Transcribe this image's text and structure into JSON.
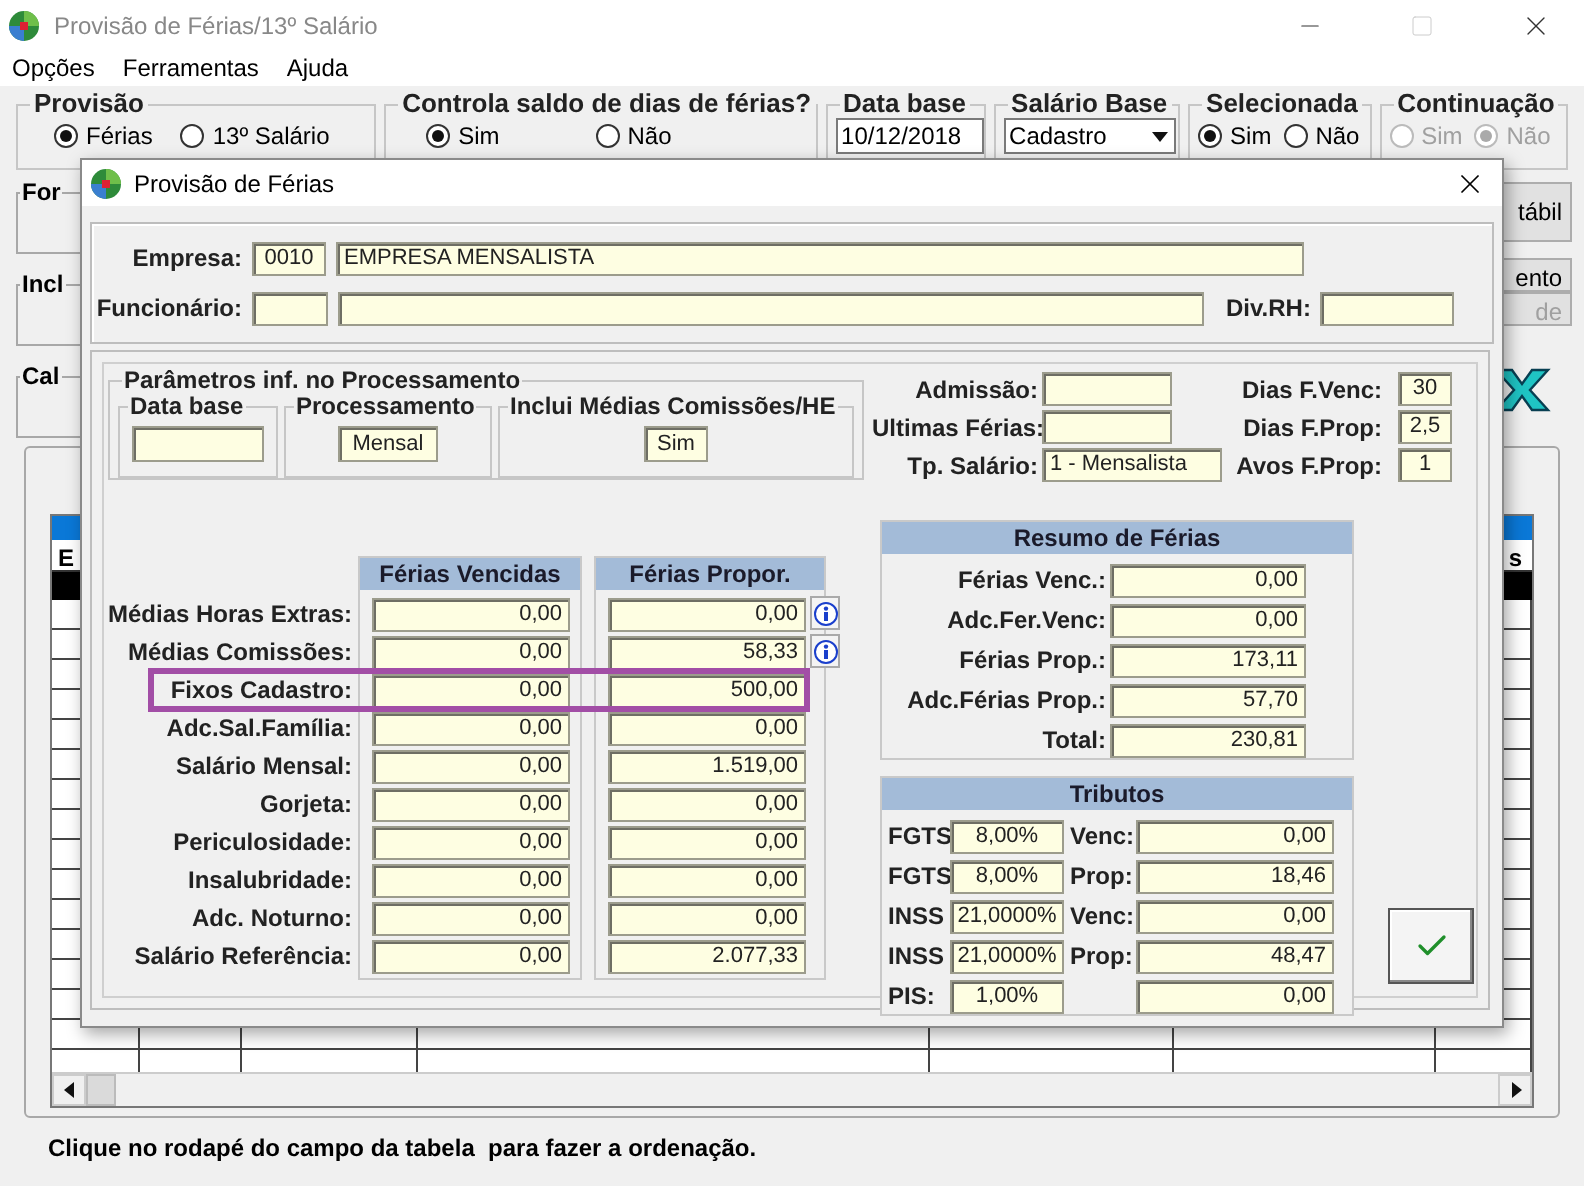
{
  "window": {
    "title": "Provisão de Férias/13º Salário"
  },
  "menu": [
    {
      "label": "Opções"
    },
    {
      "label": "Ferramentas"
    },
    {
      "label": "Ajuda"
    }
  ],
  "top_groups": [
    {
      "title": "Provisão",
      "kind": "radio",
      "options": [
        {
          "label": "Férias",
          "selected": true,
          "disabled": false
        },
        {
          "label": "13º Salário",
          "selected": false,
          "disabled": false
        }
      ]
    },
    {
      "title": "Controla saldo de dias de férias?",
      "kind": "radio",
      "options": [
        {
          "label": "Sim",
          "selected": true,
          "disabled": false
        },
        {
          "label": "Não",
          "selected": false,
          "disabled": false
        }
      ]
    },
    {
      "title": "Data base",
      "kind": "field",
      "value": "10/12/2018"
    },
    {
      "title": "Salário Base",
      "kind": "select",
      "value": "Cadastro"
    },
    {
      "title": "Selecionada",
      "kind": "radio",
      "options": [
        {
          "label": "Sim",
          "selected": true,
          "disabled": false
        },
        {
          "label": "Não",
          "selected": false,
          "disabled": false
        }
      ]
    },
    {
      "title": "Continuação",
      "kind": "radio",
      "options": [
        {
          "label": "Sim",
          "selected": false,
          "disabled": true
        },
        {
          "label": "Não",
          "selected": true,
          "disabled": true
        }
      ]
    }
  ],
  "side_groups": [
    {
      "title": "For"
    },
    {
      "title": "Incl"
    },
    {
      "title": "Cal"
    }
  ],
  "side_buttons": [
    {
      "label": "tábil",
      "disabled": false
    },
    {
      "label": "ento",
      "disabled": false
    },
    {
      "label": "de",
      "disabled": true
    }
  ],
  "grid": {
    "header_first": "E",
    "header_last": "s"
  },
  "status_bar": "Clique no rodapé do campo da tabela  para fazer a ordenação.",
  "dialog": {
    "title": "Provisão de Férias",
    "empresa": {
      "label": "Empresa:",
      "code": "0010",
      "name": "EMPRESA MENSALISTA"
    },
    "funcionario": {
      "label": "Funcionário:"
    },
    "div_rh": {
      "label": "Div.RH:"
    },
    "parametros": {
      "title": "Parâmetros inf. no Processamento",
      "groups": [
        {
          "title": "Data base"
        },
        {
          "title": "Processamento",
          "value": "Mensal"
        },
        {
          "title": "Inclui Médias Comissões/HE",
          "value": "Sim"
        }
      ]
    },
    "info_left": [
      {
        "label": "Admissão:"
      },
      {
        "label": "Ultimas Férias:"
      },
      {
        "label": "Tp. Salário:",
        "value": "1 - Mensalista"
      }
    ],
    "info_right": [
      {
        "label": "Dias F.Venc:",
        "value": "30"
      },
      {
        "label": "Dias F.Prop:",
        "value": "2,5"
      },
      {
        "label": "Avos F.Prop:",
        "value": "1"
      }
    ],
    "values": {
      "columns": [
        "Férias Vencidas",
        "Férias Propor."
      ],
      "rows": [
        {
          "label": "Médias Horas Extras:",
          "vencidas": "0,00",
          "propor": "0,00",
          "info": true,
          "highlighted": false
        },
        {
          "label": "Médias Comissões:",
          "vencidas": "0,00",
          "propor": "58,33",
          "info": true,
          "highlighted": false
        },
        {
          "label": "Fixos Cadastro:",
          "vencidas": "0,00",
          "propor": "500,00",
          "info": false,
          "highlighted": true
        },
        {
          "label": "Adc.Sal.Família:",
          "vencidas": "0,00",
          "propor": "0,00",
          "info": false,
          "highlighted": false
        },
        {
          "label": "Salário Mensal:",
          "vencidas": "0,00",
          "propor": "1.519,00",
          "info": false,
          "highlighted": false
        },
        {
          "label": "Gorjeta:",
          "vencidas": "0,00",
          "propor": "0,00",
          "info": false,
          "highlighted": false
        },
        {
          "label": "Periculosidade:",
          "vencidas": "0,00",
          "propor": "0,00",
          "info": false,
          "highlighted": false
        },
        {
          "label": "Insalubridade:",
          "vencidas": "0,00",
          "propor": "0,00",
          "info": false,
          "highlighted": false
        },
        {
          "label": "Adc. Noturno:",
          "vencidas": "0,00",
          "propor": "0,00",
          "info": false,
          "highlighted": false
        },
        {
          "label": "Salário Referência:",
          "vencidas": "0,00",
          "propor": "2.077,33",
          "info": false,
          "highlighted": false
        }
      ]
    },
    "resumo": {
      "title": "Resumo de Férias",
      "rows": [
        {
          "label": "Férias Venc.:",
          "value": "0,00"
        },
        {
          "label": "Adc.Fer.Venc:",
          "value": "0,00"
        },
        {
          "label": "Férias Prop.:",
          "value": "173,11"
        },
        {
          "label": "Adc.Férias Prop.:",
          "value": "57,70"
        },
        {
          "label": "Total:",
          "value": "230,81"
        }
      ]
    },
    "tributos": {
      "title": "Tributos",
      "rows": [
        {
          "label": "FGTS",
          "rate": "8,00%",
          "type": "Venc:",
          "value": "0,00"
        },
        {
          "label": "FGTS",
          "rate": "8,00%",
          "type": "Prop:",
          "value": "18,46"
        },
        {
          "label": "INSS",
          "rate": "21,0000%",
          "type": "Venc:",
          "value": "0,00"
        },
        {
          "label": "INSS",
          "rate": "21,0000%",
          "type": "Prop:",
          "value": "48,47"
        },
        {
          "label": "PIS:",
          "rate": "1,00%",
          "value": "0,00"
        }
      ]
    }
  }
}
